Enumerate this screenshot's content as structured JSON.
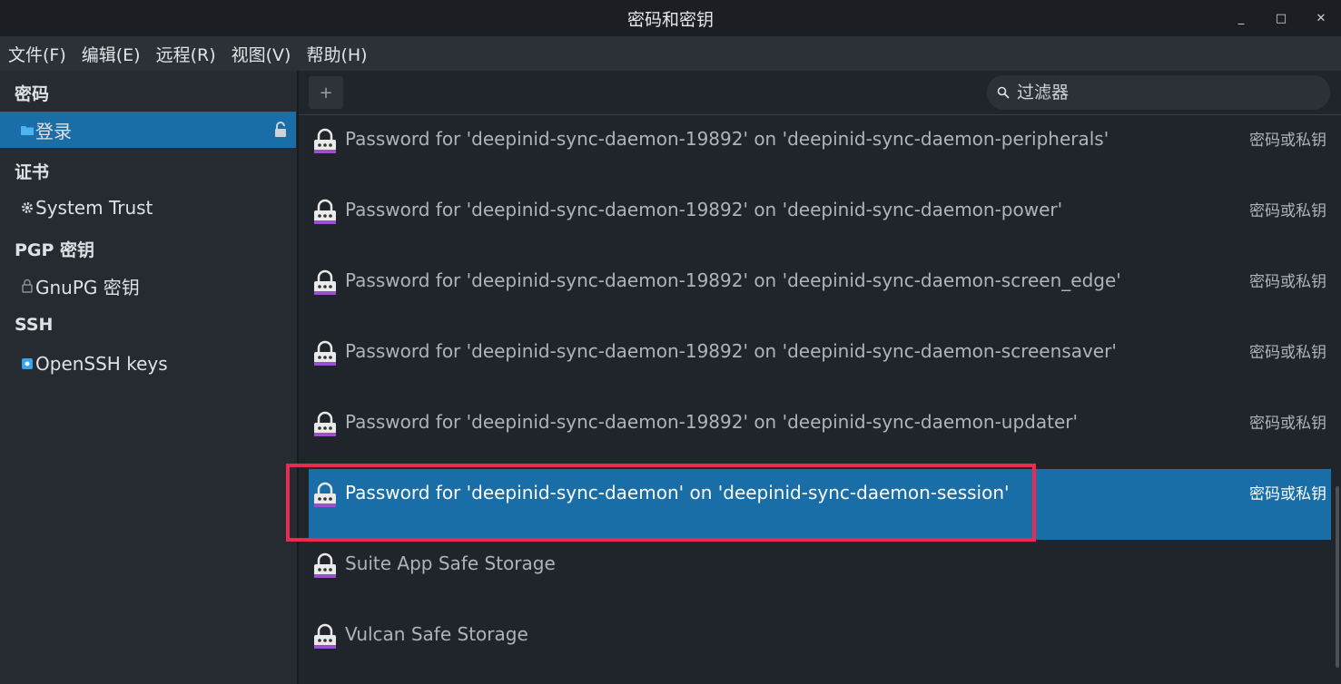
{
  "window": {
    "title": "密码和密钥",
    "controls": [
      "_",
      "□",
      "✕"
    ]
  },
  "menu": [
    "文件(F)",
    "编辑(E)",
    "远程(R)",
    "视图(V)",
    "帮助(H)"
  ],
  "sidebar": {
    "sections": [
      {
        "heading": "密码",
        "items": [
          {
            "label": "登录",
            "icon": "folder-icon",
            "selected": true,
            "locked": true
          }
        ]
      },
      {
        "heading": "证书",
        "items": [
          {
            "label": "System Trust",
            "icon": "gear-icon"
          }
        ]
      },
      {
        "heading": "PGP 密钥",
        "items": [
          {
            "label": "GnuPG 密钥",
            "icon": "lock-icon"
          }
        ]
      },
      {
        "heading": "SSH",
        "items": [
          {
            "label": "OpenSSH keys",
            "icon": "folder-icon"
          }
        ]
      }
    ]
  },
  "toolbar": {
    "add_label": "+",
    "search_placeholder": "过滤器"
  },
  "list": {
    "type_label": "密码或私钥",
    "items": [
      {
        "name": "Password for 'deepinid-sync-daemon-19892' on 'deepinid-sync-daemon-peripherals'",
        "type": "密码或私钥"
      },
      {
        "name": "Password for 'deepinid-sync-daemon-19892' on 'deepinid-sync-daemon-power'",
        "type": "密码或私钥"
      },
      {
        "name": "Password for 'deepinid-sync-daemon-19892' on 'deepinid-sync-daemon-screen_edge'",
        "type": "密码或私钥"
      },
      {
        "name": "Password for 'deepinid-sync-daemon-19892' on 'deepinid-sync-daemon-screensaver'",
        "type": "密码或私钥"
      },
      {
        "name": "Password for 'deepinid-sync-daemon-19892' on 'deepinid-sync-daemon-updater'",
        "type": "密码或私钥"
      },
      {
        "name": "Password for 'deepinid-sync-daemon' on 'deepinid-sync-daemon-session'",
        "type": "密码或私钥",
        "selected": true
      },
      {
        "name": "Suite App Safe Storage",
        "type": ""
      },
      {
        "name": "Vulcan Safe Storage",
        "type": ""
      }
    ]
  },
  "colors": {
    "accent": "#1a6ea8",
    "highlight_box": "#ea2b4f",
    "lock_purple": "#9b4fd1"
  }
}
